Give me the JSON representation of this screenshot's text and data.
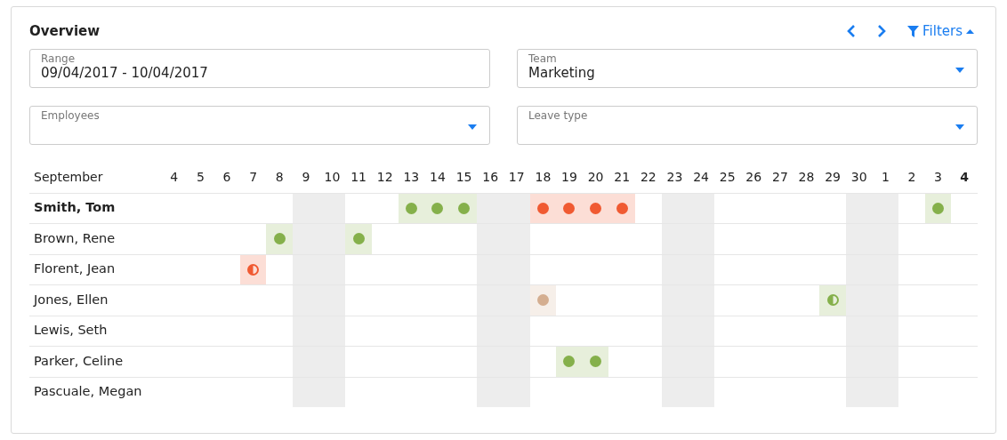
{
  "title": "Overview",
  "nav": {
    "filters_label": "Filters",
    "filters_expanded": true
  },
  "fields": [
    {
      "kind": "text",
      "label": "Range",
      "value": "09/04/2017 - 10/04/2017"
    },
    {
      "kind": "dropdown",
      "label": "Team",
      "value": "Marketing"
    },
    {
      "kind": "dropdown",
      "label": "Employees"
    },
    {
      "kind": "dropdown",
      "label": "Leave type"
    }
  ],
  "month": "September",
  "days": [
    {
      "label": "4",
      "weekend": false,
      "today": false
    },
    {
      "label": "5",
      "weekend": false,
      "today": false
    },
    {
      "label": "6",
      "weekend": false,
      "today": false
    },
    {
      "label": "7",
      "weekend": false,
      "today": false
    },
    {
      "label": "8",
      "weekend": false,
      "today": false
    },
    {
      "label": "9",
      "weekend": true,
      "today": false
    },
    {
      "label": "10",
      "weekend": true,
      "today": false
    },
    {
      "label": "11",
      "weekend": false,
      "today": false
    },
    {
      "label": "12",
      "weekend": false,
      "today": false
    },
    {
      "label": "13",
      "weekend": false,
      "today": false
    },
    {
      "label": "14",
      "weekend": false,
      "today": false
    },
    {
      "label": "15",
      "weekend": false,
      "today": false
    },
    {
      "label": "16",
      "weekend": true,
      "today": false
    },
    {
      "label": "17",
      "weekend": true,
      "today": false
    },
    {
      "label": "18",
      "weekend": false,
      "today": false
    },
    {
      "label": "19",
      "weekend": false,
      "today": false
    },
    {
      "label": "20",
      "weekend": false,
      "today": false
    },
    {
      "label": "21",
      "weekend": false,
      "today": false
    },
    {
      "label": "22",
      "weekend": false,
      "today": false
    },
    {
      "label": "23",
      "weekend": true,
      "today": false
    },
    {
      "label": "24",
      "weekend": true,
      "today": false
    },
    {
      "label": "25",
      "weekend": false,
      "today": false
    },
    {
      "label": "26",
      "weekend": false,
      "today": false
    },
    {
      "label": "27",
      "weekend": false,
      "today": false
    },
    {
      "label": "28",
      "weekend": false,
      "today": false
    },
    {
      "label": "29",
      "weekend": false,
      "today": false
    },
    {
      "label": "30",
      "weekend": true,
      "today": false
    },
    {
      "label": "1",
      "weekend": true,
      "today": false
    },
    {
      "label": "2",
      "weekend": false,
      "today": false
    },
    {
      "label": "3",
      "weekend": false,
      "today": false
    },
    {
      "label": "4",
      "weekend": false,
      "today": true
    }
  ],
  "rows": [
    {
      "name": "Smith, Tom",
      "current": true,
      "cells": [
        {
          "kind": "none"
        },
        {
          "kind": "none"
        },
        {
          "kind": "none"
        },
        {
          "kind": "none"
        },
        {
          "kind": "none"
        },
        {
          "kind": "none"
        },
        {
          "kind": "none"
        },
        {
          "kind": "none"
        },
        {
          "kind": "none"
        },
        {
          "kind": "full",
          "color": "#85b04b"
        },
        {
          "kind": "full",
          "color": "#85b04b"
        },
        {
          "kind": "full",
          "color": "#85b04b"
        },
        {
          "kind": "none"
        },
        {
          "kind": "none"
        },
        {
          "kind": "full",
          "color": "#f05a32"
        },
        {
          "kind": "full",
          "color": "#f05a32"
        },
        {
          "kind": "full",
          "color": "#f05a32"
        },
        {
          "kind": "full",
          "color": "#f05a32"
        },
        {
          "kind": "none"
        },
        {
          "kind": "none"
        },
        {
          "kind": "none"
        },
        {
          "kind": "none"
        },
        {
          "kind": "none"
        },
        {
          "kind": "none"
        },
        {
          "kind": "none"
        },
        {
          "kind": "none"
        },
        {
          "kind": "none"
        },
        {
          "kind": "none"
        },
        {
          "kind": "none"
        },
        {
          "kind": "full",
          "color": "#85b04b"
        },
        {
          "kind": "none"
        }
      ]
    },
    {
      "name": "Brown, Rene",
      "current": false,
      "cells": [
        {
          "kind": "none"
        },
        {
          "kind": "none"
        },
        {
          "kind": "none"
        },
        {
          "kind": "none"
        },
        {
          "kind": "full",
          "color": "#85b04b"
        },
        {
          "kind": "none"
        },
        {
          "kind": "none"
        },
        {
          "kind": "full",
          "color": "#85b04b"
        },
        {
          "kind": "none"
        },
        {
          "kind": "none"
        },
        {
          "kind": "none"
        },
        {
          "kind": "none"
        },
        {
          "kind": "none"
        },
        {
          "kind": "none"
        },
        {
          "kind": "none"
        },
        {
          "kind": "none"
        },
        {
          "kind": "none"
        },
        {
          "kind": "none"
        },
        {
          "kind": "none"
        },
        {
          "kind": "none"
        },
        {
          "kind": "none"
        },
        {
          "kind": "none"
        },
        {
          "kind": "none"
        },
        {
          "kind": "none"
        },
        {
          "kind": "none"
        },
        {
          "kind": "none"
        },
        {
          "kind": "none"
        },
        {
          "kind": "none"
        },
        {
          "kind": "none"
        },
        {
          "kind": "none"
        },
        {
          "kind": "none"
        }
      ]
    },
    {
      "name": "Florent, Jean",
      "current": false,
      "cells": [
        {
          "kind": "none"
        },
        {
          "kind": "none"
        },
        {
          "kind": "none"
        },
        {
          "kind": "half",
          "color": "#f05a32"
        },
        {
          "kind": "none"
        },
        {
          "kind": "none"
        },
        {
          "kind": "none"
        },
        {
          "kind": "none"
        },
        {
          "kind": "none"
        },
        {
          "kind": "none"
        },
        {
          "kind": "none"
        },
        {
          "kind": "none"
        },
        {
          "kind": "none"
        },
        {
          "kind": "none"
        },
        {
          "kind": "none"
        },
        {
          "kind": "none"
        },
        {
          "kind": "none"
        },
        {
          "kind": "none"
        },
        {
          "kind": "none"
        },
        {
          "kind": "none"
        },
        {
          "kind": "none"
        },
        {
          "kind": "none"
        },
        {
          "kind": "none"
        },
        {
          "kind": "none"
        },
        {
          "kind": "none"
        },
        {
          "kind": "none"
        },
        {
          "kind": "none"
        },
        {
          "kind": "none"
        },
        {
          "kind": "none"
        },
        {
          "kind": "none"
        },
        {
          "kind": "none"
        }
      ]
    },
    {
      "name": "Jones, Ellen",
      "current": false,
      "cells": [
        {
          "kind": "none"
        },
        {
          "kind": "none"
        },
        {
          "kind": "none"
        },
        {
          "kind": "none"
        },
        {
          "kind": "none"
        },
        {
          "kind": "none"
        },
        {
          "kind": "none"
        },
        {
          "kind": "none"
        },
        {
          "kind": "none"
        },
        {
          "kind": "none"
        },
        {
          "kind": "none"
        },
        {
          "kind": "none"
        },
        {
          "kind": "none"
        },
        {
          "kind": "none"
        },
        {
          "kind": "full",
          "color": "#d4ae90"
        },
        {
          "kind": "none"
        },
        {
          "kind": "none"
        },
        {
          "kind": "none"
        },
        {
          "kind": "none"
        },
        {
          "kind": "none"
        },
        {
          "kind": "none"
        },
        {
          "kind": "none"
        },
        {
          "kind": "none"
        },
        {
          "kind": "none"
        },
        {
          "kind": "none"
        },
        {
          "kind": "half",
          "color": "#85b04b"
        },
        {
          "kind": "none"
        },
        {
          "kind": "none"
        },
        {
          "kind": "none"
        },
        {
          "kind": "none"
        },
        {
          "kind": "none"
        }
      ]
    },
    {
      "name": "Lewis, Seth",
      "current": false,
      "cells": [
        {
          "kind": "none"
        },
        {
          "kind": "none"
        },
        {
          "kind": "none"
        },
        {
          "kind": "none"
        },
        {
          "kind": "none"
        },
        {
          "kind": "none"
        },
        {
          "kind": "none"
        },
        {
          "kind": "none"
        },
        {
          "kind": "none"
        },
        {
          "kind": "none"
        },
        {
          "kind": "none"
        },
        {
          "kind": "none"
        },
        {
          "kind": "none"
        },
        {
          "kind": "none"
        },
        {
          "kind": "none"
        },
        {
          "kind": "none"
        },
        {
          "kind": "none"
        },
        {
          "kind": "none"
        },
        {
          "kind": "none"
        },
        {
          "kind": "none"
        },
        {
          "kind": "none"
        },
        {
          "kind": "none"
        },
        {
          "kind": "none"
        },
        {
          "kind": "none"
        },
        {
          "kind": "none"
        },
        {
          "kind": "none"
        },
        {
          "kind": "none"
        },
        {
          "kind": "none"
        },
        {
          "kind": "none"
        },
        {
          "kind": "none"
        },
        {
          "kind": "none"
        }
      ]
    },
    {
      "name": "Parker, Celine",
      "current": false,
      "cells": [
        {
          "kind": "none"
        },
        {
          "kind": "none"
        },
        {
          "kind": "none"
        },
        {
          "kind": "none"
        },
        {
          "kind": "none"
        },
        {
          "kind": "none"
        },
        {
          "kind": "none"
        },
        {
          "kind": "none"
        },
        {
          "kind": "none"
        },
        {
          "kind": "none"
        },
        {
          "kind": "none"
        },
        {
          "kind": "none"
        },
        {
          "kind": "none"
        },
        {
          "kind": "none"
        },
        {
          "kind": "none"
        },
        {
          "kind": "full",
          "color": "#85b04b"
        },
        {
          "kind": "full",
          "color": "#85b04b"
        },
        {
          "kind": "none"
        },
        {
          "kind": "none"
        },
        {
          "kind": "none"
        },
        {
          "kind": "none"
        },
        {
          "kind": "none"
        },
        {
          "kind": "none"
        },
        {
          "kind": "none"
        },
        {
          "kind": "none"
        },
        {
          "kind": "none"
        },
        {
          "kind": "none"
        },
        {
          "kind": "none"
        },
        {
          "kind": "none"
        },
        {
          "kind": "none"
        },
        {
          "kind": "none"
        }
      ]
    },
    {
      "name": "Pascuale, Megan",
      "current": false,
      "cells": [
        {
          "kind": "none"
        },
        {
          "kind": "none"
        },
        {
          "kind": "none"
        },
        {
          "kind": "none"
        },
        {
          "kind": "none"
        },
        {
          "kind": "none"
        },
        {
          "kind": "none"
        },
        {
          "kind": "none"
        },
        {
          "kind": "none"
        },
        {
          "kind": "none"
        },
        {
          "kind": "none"
        },
        {
          "kind": "none"
        },
        {
          "kind": "none"
        },
        {
          "kind": "none"
        },
        {
          "kind": "none"
        },
        {
          "kind": "none"
        },
        {
          "kind": "none"
        },
        {
          "kind": "none"
        },
        {
          "kind": "none"
        },
        {
          "kind": "none"
        },
        {
          "kind": "none"
        },
        {
          "kind": "none"
        },
        {
          "kind": "none"
        },
        {
          "kind": "none"
        },
        {
          "kind": "none"
        },
        {
          "kind": "none"
        },
        {
          "kind": "none"
        },
        {
          "kind": "none"
        },
        {
          "kind": "none"
        },
        {
          "kind": "none"
        },
        {
          "kind": "none"
        }
      ]
    }
  ]
}
